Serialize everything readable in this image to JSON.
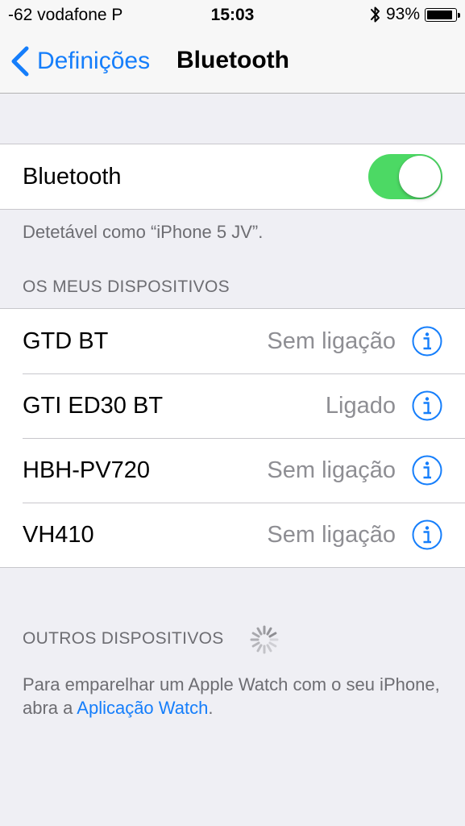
{
  "status_bar": {
    "carrier": "-62 vodafone P",
    "time": "15:03",
    "battery_percent": "93%",
    "battery_level": 0.93,
    "bluetooth_icon": "bluetooth-icon"
  },
  "nav": {
    "back_label": "Definições",
    "title": "Bluetooth"
  },
  "bluetooth": {
    "label": "Bluetooth",
    "enabled": true,
    "discoverable_text": "Detetável como “iPhone 5 JV”."
  },
  "my_devices": {
    "header": "OS MEUS DISPOSITIVOS",
    "items": [
      {
        "name": "GTD BT",
        "status": "Sem ligação"
      },
      {
        "name": "GTI ED30 BT",
        "status": "Ligado"
      },
      {
        "name": "HBH-PV720",
        "status": "Sem ligação"
      },
      {
        "name": "VH410",
        "status": "Sem ligação"
      }
    ]
  },
  "other_devices": {
    "header": "OUTROS DISPOSITIVOS",
    "pairing_text_before": "Para emparelhar um Apple Watch com o seu iPhone, abra a ",
    "pairing_link": "Aplicação Watch",
    "pairing_text_after": "."
  },
  "colors": {
    "accent": "#157efb",
    "toggle_on": "#4cd964",
    "secondary_text": "#8e8e93",
    "background": "#efeff4"
  }
}
